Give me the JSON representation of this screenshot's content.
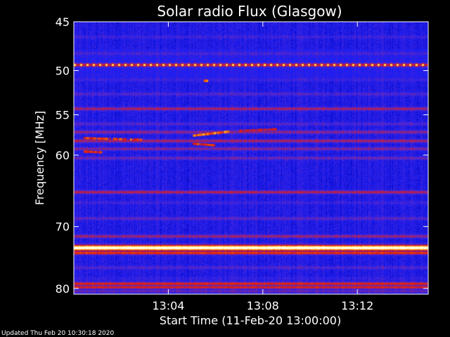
{
  "chart_data": {
    "type": "heatmap",
    "title": "Solar radio Flux (Glasgow)",
    "xlabel": "Start Time (11-Feb-20 13:00:00)",
    "ylabel": "Frequency [MHz]",
    "x_unit": "minutes after 13:00:00",
    "x_range": [
      0,
      15
    ],
    "x_ticks": [
      {
        "value": 4,
        "label": "13:04"
      },
      {
        "value": 8,
        "label": "13:08"
      },
      {
        "value": 12,
        "label": "13:12"
      }
    ],
    "y_scale": "log",
    "y_range": [
      45,
      81
    ],
    "y_ticks": [
      {
        "value": 45,
        "label": "45"
      },
      {
        "value": 50,
        "label": "50"
      },
      {
        "value": 55,
        "label": "55"
      },
      {
        "value": 60,
        "label": "60"
      },
      {
        "value": 70,
        "label": "70"
      },
      {
        "value": 80,
        "label": "80"
      }
    ],
    "colormap": [
      "#00003c",
      "#0000b4",
      "#1e1ef0",
      "#5a28c8",
      "#b41e50",
      "#e61e00",
      "#ff7800",
      "#ffdc3c",
      "#ffffe6"
    ],
    "background_level": 0.25,
    "bands": [
      {
        "freq": 45.2,
        "intensity": 0.2
      },
      {
        "freq": 46.5,
        "intensity": 0.32
      },
      {
        "freq": 48.2,
        "intensity": 0.34
      },
      {
        "freq": 49.4,
        "intensity": 0.7,
        "pulsed": true
      },
      {
        "freq": 51.0,
        "intensity": 0.32
      },
      {
        "freq": 52.6,
        "intensity": 0.36
      },
      {
        "freq": 54.3,
        "intensity": 0.5
      },
      {
        "freq": 56.1,
        "intensity": 0.36
      },
      {
        "freq": 57.1,
        "intensity": 0.46
      },
      {
        "freq": 58.2,
        "intensity": 0.5
      },
      {
        "freq": 59.2,
        "intensity": 0.44
      },
      {
        "freq": 60.4,
        "intensity": 0.4
      },
      {
        "freq": 62.5,
        "intensity": 0.22
      },
      {
        "freq": 65.0,
        "intensity": 0.52
      },
      {
        "freq": 66.5,
        "intensity": 0.32
      },
      {
        "freq": 68.8,
        "intensity": 0.38
      },
      {
        "freq": 71.5,
        "intensity": 0.48
      },
      {
        "freq": 73.3,
        "intensity": 1.0
      },
      {
        "freq": 74.1,
        "intensity": 0.66
      },
      {
        "freq": 76.5,
        "intensity": 0.36
      },
      {
        "freq": 78.3,
        "intensity": 0.3
      },
      {
        "freq": 79.2,
        "intensity": 0.62
      },
      {
        "freq": 79.8,
        "intensity": 0.6
      },
      {
        "freq": 80.5,
        "intensity": 0.4
      }
    ],
    "events": [
      {
        "t_start": 0.4,
        "t_end": 2.8,
        "freq_start": 57.8,
        "freq_end": 58.0,
        "intensity": 0.6
      },
      {
        "t_start": 0.4,
        "t_end": 1.1,
        "freq_start": 59.5,
        "freq_end": 59.6,
        "intensity": 0.55
      },
      {
        "t_start": 5.0,
        "t_end": 6.5,
        "freq_start": 57.5,
        "freq_end": 57.0,
        "intensity": 0.7
      },
      {
        "t_start": 5.0,
        "t_end": 5.9,
        "freq_start": 58.5,
        "freq_end": 58.7,
        "intensity": 0.6
      },
      {
        "t_start": 7.0,
        "t_end": 8.5,
        "freq_start": 56.9,
        "freq_end": 56.7,
        "intensity": 0.5
      },
      {
        "t_start": 5.5,
        "t_end": 5.6,
        "freq_start": 51.1,
        "freq_end": 51.1,
        "intensity": 0.65
      }
    ]
  },
  "footer": {
    "updated_text": "Updated Thu Feb 20 10:30:18 2020"
  }
}
